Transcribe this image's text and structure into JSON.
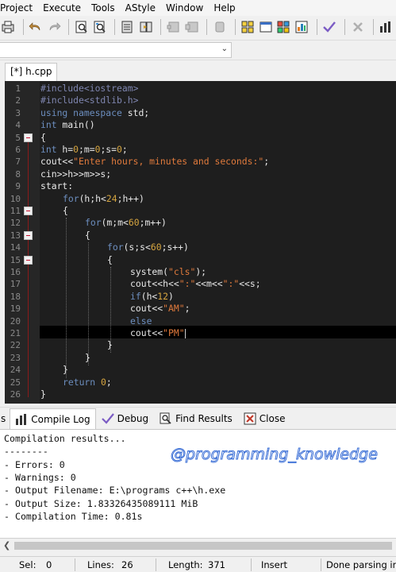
{
  "menu": [
    "Project",
    "Execute",
    "Tools",
    "AStyle",
    "Window",
    "Help"
  ],
  "editor_tab": "[*] h.cpp",
  "line_numbers": [
    "1",
    "2",
    "3",
    "4",
    "5",
    "6",
    "7",
    "8",
    "9",
    "10",
    "11",
    "12",
    "13",
    "14",
    "15",
    "16",
    "17",
    "18",
    "19",
    "20",
    "21",
    "22",
    "23",
    "24",
    "25",
    "26"
  ],
  "code": {
    "l1": "#include<iostream>",
    "l2": "#include<stdlib.h>",
    "l3_kw": "using namespace",
    "l3_rest": " std;",
    "l4_kw": "int",
    "l4_rest": " main()",
    "l5": "{",
    "l6_kw": "int",
    "l6_a": " h=",
    "l6_n1": "0",
    "l6_b": ";m=",
    "l6_n2": "0",
    "l6_c": ";s=",
    "l6_n3": "0",
    "l6_d": ";",
    "l7_a": "cout<<",
    "l7_str": "\"Enter hours, minutes and seconds:\"",
    "l7_b": ";",
    "l8": "cin>>h>>m>>s;",
    "l9": "start:",
    "l10_kw": "for",
    "l10_a": "(h;h<",
    "l10_n": "24",
    "l10_b": ";h++)",
    "l11": "{",
    "l12_kw": "for",
    "l12_a": "(m;m<",
    "l12_n": "60",
    "l12_b": ";m++)",
    "l13": "{",
    "l14_kw": "for",
    "l14_a": "(s;s<",
    "l14_n": "60",
    "l14_b": ";s++)",
    "l15": "{",
    "l16_a": "system(",
    "l16_str": "\"cls\"",
    "l16_b": ");",
    "l17_a": "cout<<h<<",
    "l17_s1": "\":\"",
    "l17_b": "<<m<<",
    "l17_s2": "\":\"",
    "l17_c": "<<s;",
    "l18_kw": "if",
    "l18_a": "(h<",
    "l18_n": "12",
    "l18_b": ")",
    "l19_a": "cout<<",
    "l19_str": "\"AM\"",
    "l19_b": ";",
    "l20_kw": "else",
    "l21_a": "cout<<",
    "l21_str": "\"PM\"",
    "l22": "}",
    "l23": "}",
    "l24": "}",
    "l25_kw": "return",
    "l25_sp": " ",
    "l25_n": "0",
    "l25_b": ";",
    "l26": "}"
  },
  "bottom_tabs": {
    "compile_log": "Compile Log",
    "debug": "Debug",
    "find_results": "Find Results",
    "close": "Close",
    "cut_label": "s"
  },
  "output_lines": [
    "Compilation results...",
    "--------",
    "- Errors: 0",
    "- Warnings: 0",
    "- Output Filename: E:\\programs c++\\h.exe",
    "- Output Size: 1.83326435089111 MiB",
    "- Compilation Time: 0.81s"
  ],
  "watermark": "@programming_knowledge",
  "status": {
    "sel_label": "Sel:",
    "sel_value": "0",
    "lines_label": "Lines:",
    "lines_value": "26",
    "length_label": "Length:",
    "length_value": "371",
    "mode": "Insert",
    "message": "Done parsing in"
  }
}
